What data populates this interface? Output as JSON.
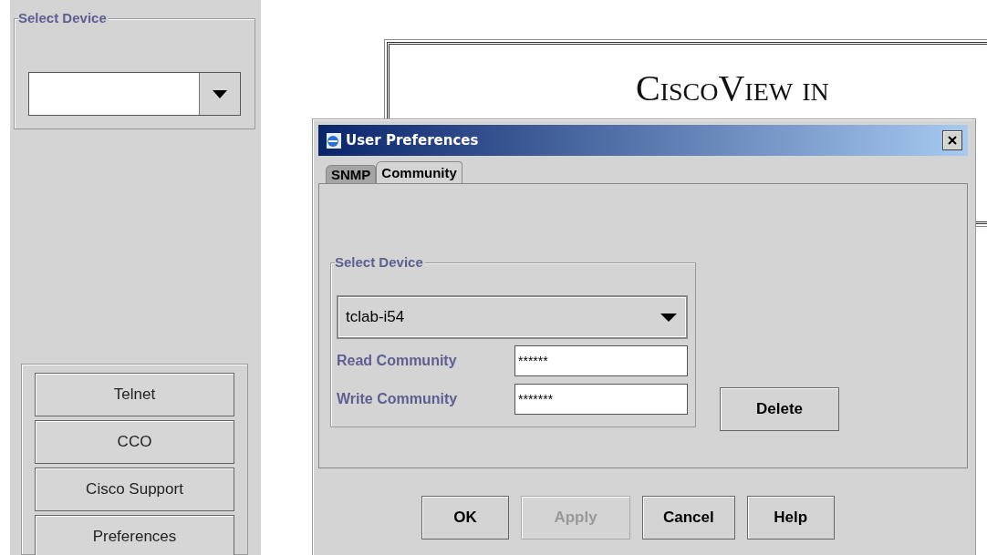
{
  "sidebar": {
    "device_group": {
      "legend": "Select Device"
    },
    "buttons": [
      "Telnet",
      "CCO",
      "Cisco Support",
      "Preferences"
    ]
  },
  "background_page": {
    "heading": "CiscoView in"
  },
  "dialog": {
    "title": "User Preferences",
    "tabs": [
      {
        "label": "SNMP",
        "selected": false
      },
      {
        "label": "Community",
        "selected": true
      }
    ],
    "device_group": {
      "legend": "Select Device",
      "value": "tclab-i54"
    },
    "fields": [
      {
        "label": "Read Community",
        "value": "******"
      },
      {
        "label": "Write Community",
        "value": "*******"
      }
    ],
    "delete_button": "Delete",
    "buttons": [
      {
        "label": "OK",
        "disabled": false
      },
      {
        "label": "Apply",
        "disabled": true
      },
      {
        "label": "Cancel",
        "disabled": false
      },
      {
        "label": "Help",
        "disabled": false
      }
    ]
  }
}
